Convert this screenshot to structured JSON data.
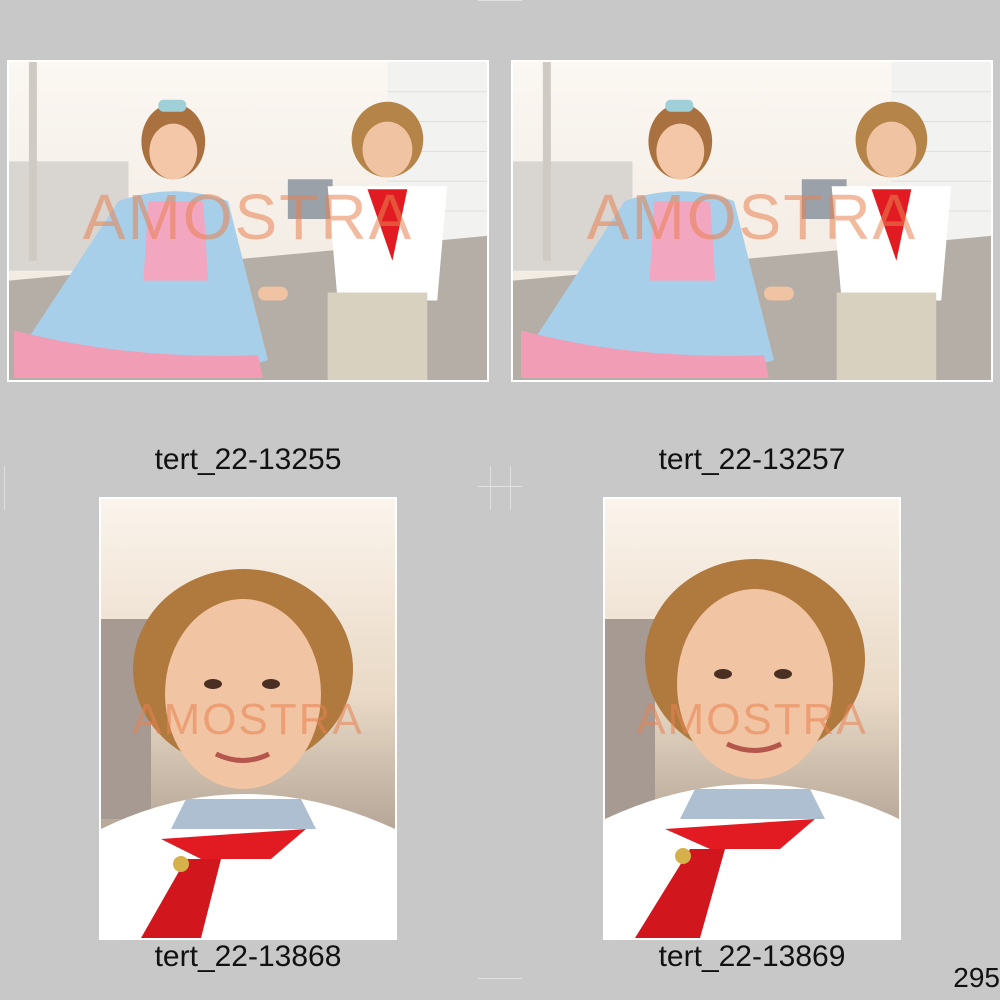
{
  "sheet": {
    "page_number": "295",
    "photos": [
      {
        "id": "photo-1",
        "caption": "tert_22-13255",
        "watermark": "AMOSTRA",
        "orientation": "landscape"
      },
      {
        "id": "photo-2",
        "caption": "tert_22-13257",
        "watermark": "AMOSTRA",
        "orientation": "landscape"
      },
      {
        "id": "photo-3",
        "caption": "tert_22-13868",
        "watermark": "AMOSTRA",
        "orientation": "portrait"
      },
      {
        "id": "photo-4",
        "caption": "tert_22-13869",
        "watermark": "AMOSTRA",
        "orientation": "portrait"
      }
    ]
  },
  "colors": {
    "background": "#c8c8c8",
    "watermark": "#e88250",
    "scarf": "#e21b23",
    "dress_blue": "#9ec9e8",
    "dress_pink": "#f29bb3"
  }
}
